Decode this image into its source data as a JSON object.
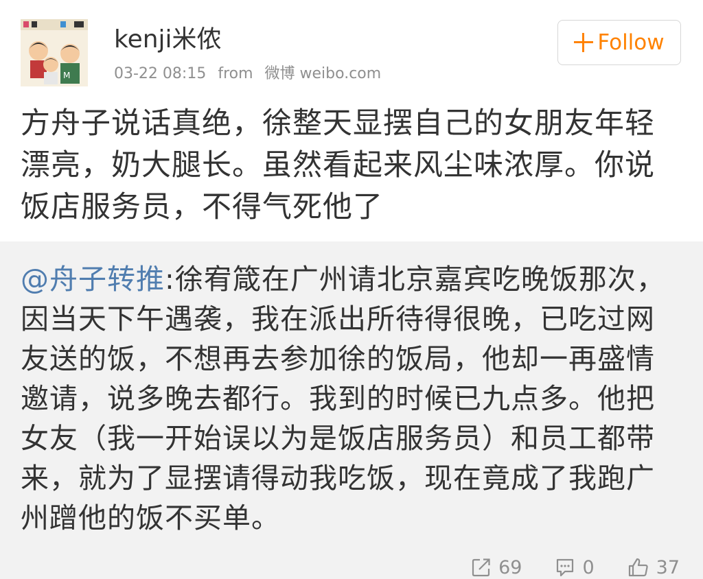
{
  "header": {
    "username": "kenji米侬",
    "timestamp": "03-22 08:15",
    "from_label": "from",
    "via": "微博 weibo.com",
    "follow_label": "Follow",
    "avatar_icon": "cartoon-avatar-icon"
  },
  "post": {
    "text": "方舟子说话真绝，徐整天显摆自己的女朋友年轻漂亮，奶大腿长。虽然看起来风尘味浓厚。你说饭店服务员，不得气死他了"
  },
  "retweet": {
    "author": "@舟子转推",
    "separator": ":",
    "text": "徐宥箴在广州请北京嘉宾吃晚饭那次，因当天下午遇袭，我在派出所待得很晚，已吃过网友送的饭，不想再去参加徐的饭局，他却一再盛情邀请，说多晚去都行。我到的时候已九点多。他把女友（我一开始误以为是饭店服务员）和员工都带来，就为了显摆请得动我吃饭，现在竟成了我跑广州蹭他的饭不买单。",
    "actions": {
      "repost_count": "69",
      "comment_count": "0",
      "like_count": "37"
    }
  },
  "colors": {
    "accent_orange": "#ff8200",
    "link_blue": "#507daf",
    "text_dark": "#333333",
    "text_gray": "#8f8f8f",
    "retweet_bg": "#f2f2f2"
  }
}
